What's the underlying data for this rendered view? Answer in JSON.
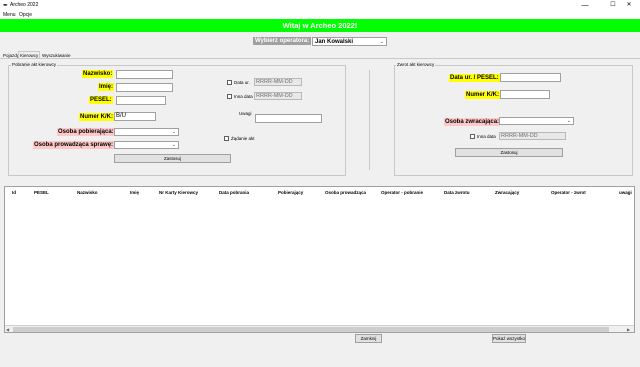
{
  "window": {
    "title": "Archeo 2022",
    "app_icon": "feather-icon",
    "minimize": "—",
    "maximize": "☐",
    "close": "✕"
  },
  "menu": {
    "items": [
      "Menu",
      "Opcje"
    ]
  },
  "banner": {
    "text": "Witaj w Archeo 2022!",
    "color": "#00ff00"
  },
  "operator": {
    "label": "Wybierz operatora:",
    "selected": "Jan Kowalski"
  },
  "tabs": [
    "Pojazdy",
    "Kierowcy",
    "Wyszukiwanie"
  ],
  "active_tab": "Kierowcy",
  "left_panel": {
    "legend": "Pobranie akt kierowcy",
    "nazwisko_label": "Nazwisko:",
    "imie_label": "Imię:",
    "pesel_label": "PESEL:",
    "numer_kk_label": "Numer K/K:",
    "numer_kk_value": "B/U",
    "osoba_pobierajaca_label": "Osoba pobierająca:",
    "osoba_prowadzaca_label": "Osoba prowadząca sprawę:",
    "data_ur_label": "Data ur.",
    "data_ur_placeholder": "RRRR-MM-DD",
    "inna_data_label": "Inna data",
    "inna_data_placeholder": "RRRR-MM-DD",
    "uwagi_label": "Uwagi",
    "zadanie_akt_label": "Żądanie akt",
    "submit_label": "Zastosuj"
  },
  "right_panel": {
    "legend": "Zwrot akt kierowcy",
    "data_pesel_label": "Data ur. / PESEL:",
    "numer_kk_label": "Numer K/K:",
    "osoba_zwracajaca_label": "Osoba zwracająca:",
    "inna_data_label": "Inna data",
    "inna_data_placeholder": "RRRR-MM-DD",
    "submit_label": "Zastosuj"
  },
  "table": {
    "columns": [
      "Id",
      "PESEL",
      "Nazwisko",
      "Imię",
      "Nr Karty Kierowcy",
      "Data pobrania",
      "Pobierający",
      "Osoba prowadząca",
      "Operator - pobranie",
      "Data zwrotu",
      "Zwracający",
      "Operator - zwrot",
      "uwagi"
    ],
    "rows": []
  },
  "footer": {
    "close_label": "Zamknij",
    "show_all_label": "Pokaż wszystko"
  }
}
